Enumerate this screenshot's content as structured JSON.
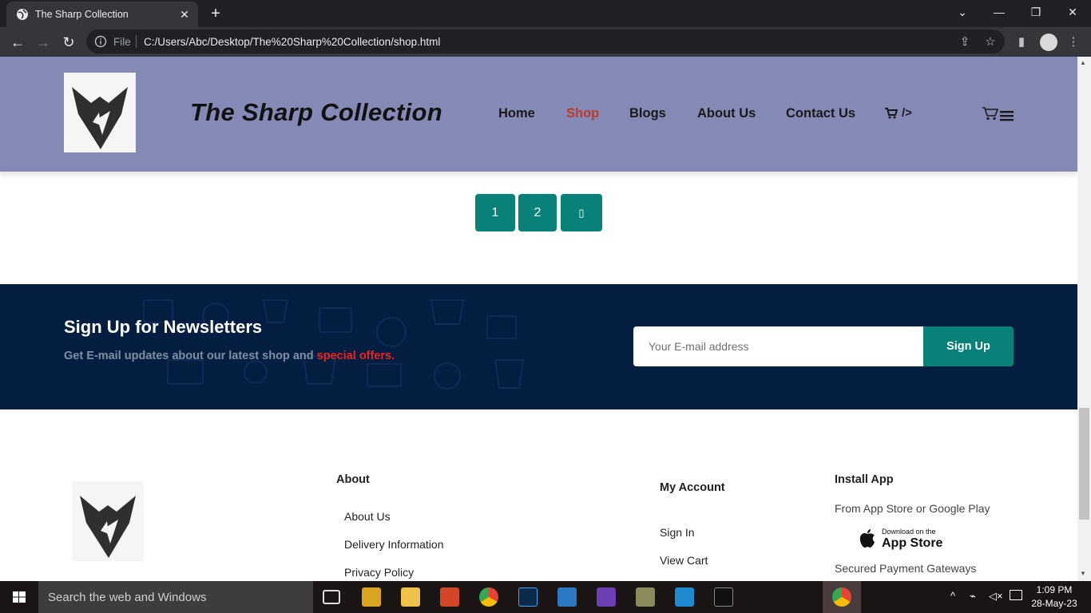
{
  "browser": {
    "tab_title": "The Sharp Collection",
    "new_tab_label": "+",
    "file_label": "File",
    "url": "C:/Users/Abc/Desktop/The%20Sharp%20Collection/shop.html"
  },
  "site": {
    "brand": "The Sharp Collection",
    "nav": [
      {
        "label": "Home"
      },
      {
        "label": "Shop"
      },
      {
        "label": "Blogs"
      },
      {
        "label": "About Us"
      },
      {
        "label": "Contact Us"
      }
    ],
    "nav_cart_suffix": "/>",
    "active_nav": "Shop"
  },
  "pagination": {
    "pages": [
      "1",
      "2"
    ],
    "next_glyph": "▯"
  },
  "newsletter": {
    "title": "Sign Up for Newsletters",
    "subtitle_prefix": "Get E-mail updates about our latest shop and",
    "subtitle_highlight": "special offers.",
    "email_placeholder": "Your E-mail address",
    "button": "Sign Up",
    "accent_color": "#088178",
    "highlight_color": "#e8251f"
  },
  "footer": {
    "about": {
      "heading": "About",
      "links": [
        "About Us",
        "Delivery Information",
        "Privacy Policy"
      ]
    },
    "account": {
      "heading": "My Account",
      "links": [
        "Sign In",
        "View Cart"
      ]
    },
    "app": {
      "heading": "Install App",
      "text": "From App Store or Google Play",
      "badge_small": "Download on the",
      "badge_big": "App Store",
      "payments": "Secured Payment Gateways"
    }
  },
  "taskbar": {
    "search_placeholder": "Search the web and Windows",
    "time": "1:09 PM",
    "date": "28-May-23"
  }
}
